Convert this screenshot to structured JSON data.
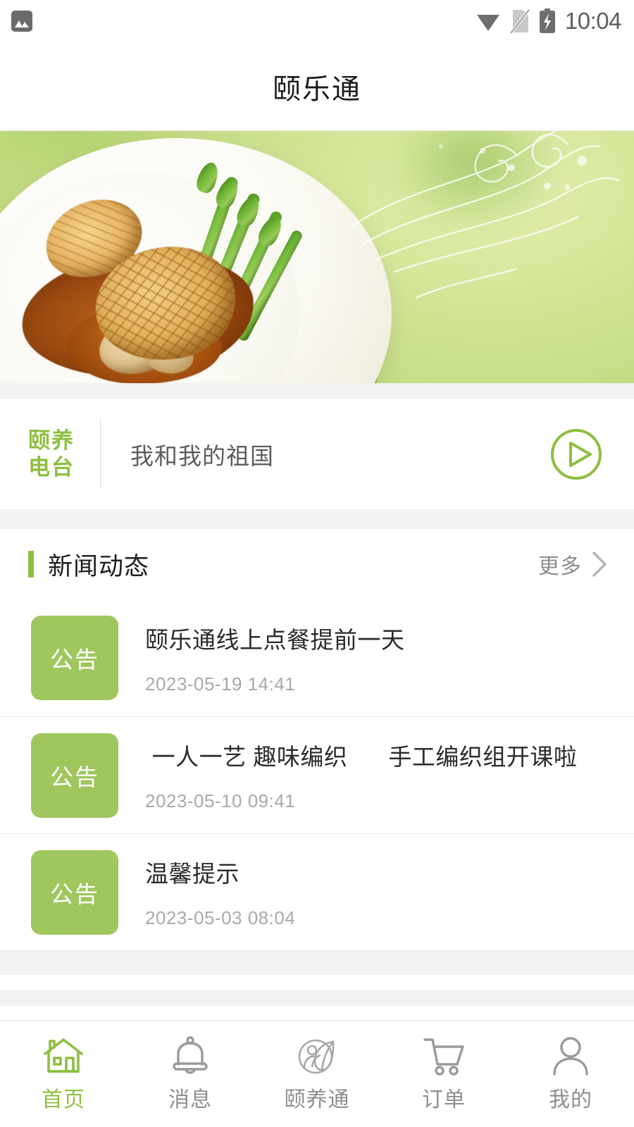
{
  "statusbar": {
    "notification_icon": "image-icon",
    "wifi_icon": "wifi-icon",
    "sim_icon": "sim-card-off-icon",
    "battery_icon": "battery-charging-icon",
    "time": "10:04"
  },
  "header": {
    "title": "颐乐通"
  },
  "banner": {
    "alt": "braised-abalone-with-asparagus-banner",
    "bg_color": "#cbe08d"
  },
  "radio": {
    "label_line1": "颐养",
    "label_line2": "电台",
    "now_playing": "我和我的祖国",
    "play_icon": "play-circle-icon",
    "accent_color": "#8cbf3f"
  },
  "news": {
    "section_title": "新闻动态",
    "more_label": "更多",
    "chevron_icon": "chevron-right-icon",
    "items": [
      {
        "badge": "公告",
        "title": "颐乐通线上点餐提前一天",
        "date": "2023-05-19 14:41"
      },
      {
        "badge": "公告",
        "title": " 一人一艺 趣味编织      手工编织组开课啦",
        "date": "2023-05-10 09:41"
      },
      {
        "badge": "公告",
        "title": "温馨提示",
        "date": "2023-05-03 08:04"
      }
    ]
  },
  "tabbar": {
    "active_color": "#8cbf3f",
    "inactive_color": "#8e8e8e",
    "items": [
      {
        "label": "首页",
        "icon": "home-icon",
        "active": true
      },
      {
        "label": "消息",
        "icon": "bell-icon",
        "active": false
      },
      {
        "label": "颐养通",
        "icon": "leaf-person-circle-icon",
        "active": false
      },
      {
        "label": "订单",
        "icon": "shopping-cart-icon",
        "active": false
      },
      {
        "label": "我的",
        "icon": "user-icon",
        "active": false
      }
    ]
  }
}
